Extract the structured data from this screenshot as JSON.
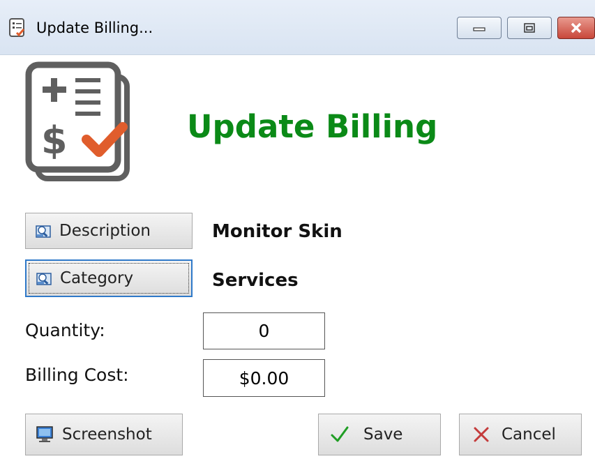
{
  "window": {
    "title": "Update Billing...",
    "controls": {
      "minimize": "minimize",
      "maximize": "maximize",
      "close": "close"
    }
  },
  "header": {
    "heading": "Update Billing",
    "icon": "billing-checklist-icon"
  },
  "fields": {
    "description_button_label": "Description",
    "description_value": "Monitor Skin",
    "category_button_label": "Category",
    "category_value": "Services",
    "quantity_label": "Quantity:",
    "quantity_value": "0",
    "billing_cost_label": "Billing Cost:",
    "billing_cost_value": "$0.00"
  },
  "actions": {
    "screenshot_label": "Screenshot",
    "save_label": "Save",
    "cancel_label": "Cancel"
  },
  "colors": {
    "heading": "#0b8a17",
    "focus_border": "#2f79c9",
    "check_mark": "#e05d2c",
    "save_check": "#1f9d23",
    "cancel_x": "#c43b3b"
  }
}
